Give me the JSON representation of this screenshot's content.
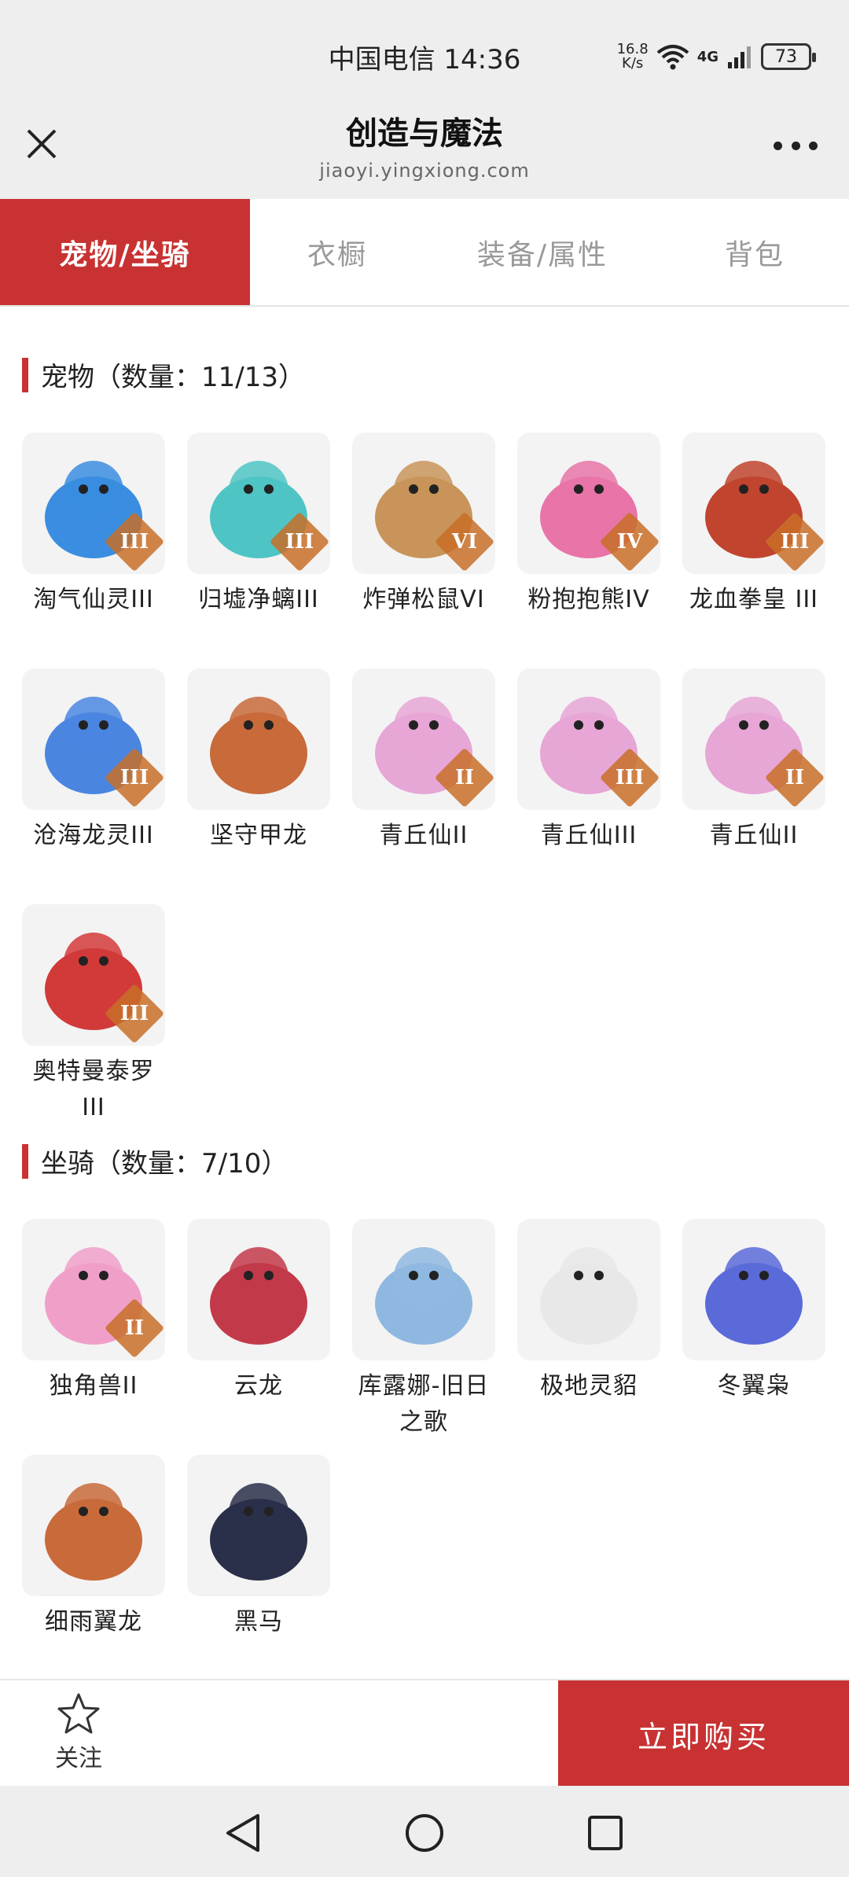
{
  "status_bar": {
    "carrier_time": "中国电信 14:36",
    "net_speed_top": "16.8",
    "net_speed_bottom": "K/s",
    "network": "4G",
    "battery": "73"
  },
  "title_bar": {
    "title": "创造与魔法",
    "subtitle": "jiaoyi.yingxiong.com"
  },
  "tabs": [
    {
      "label": "宠物/坐骑",
      "active": true
    },
    {
      "label": "衣橱",
      "active": false
    },
    {
      "label": "装备/属性",
      "active": false
    },
    {
      "label": "背包",
      "active": false
    }
  ],
  "pets_section": {
    "title": "宠物（数量：11/13）",
    "items": [
      {
        "name": "淘气仙灵III",
        "badge": "III",
        "icon": "blue-creature-icon",
        "color": "#3a8de0"
      },
      {
        "name": "归墟净螭III",
        "badge": "III",
        "icon": "cyan-dragon-icon",
        "color": "#4fc4c4"
      },
      {
        "name": "炸弹松鼠VI",
        "badge": "VI",
        "icon": "squirrel-icon",
        "color": "#c8945a"
      },
      {
        "name": "粉抱抱熊IV",
        "badge": "IV",
        "icon": "pink-bear-icon",
        "color": "#e874a8"
      },
      {
        "name": "龙血拳皇 III",
        "badge": "III",
        "icon": "red-beast-icon",
        "color": "#c0442e"
      },
      {
        "name": "沧海龙灵III",
        "badge": "III",
        "icon": "blue-spirit-icon",
        "color": "#4a86e0"
      },
      {
        "name": "坚守甲龙",
        "badge": "",
        "icon": "armored-dragon-icon",
        "color": "#c86a3a"
      },
      {
        "name": "青丘仙II",
        "badge": "II",
        "icon": "fox-spirit-icon",
        "color": "#e6a6d6"
      },
      {
        "name": "青丘仙III",
        "badge": "III",
        "icon": "fox-spirit-icon",
        "color": "#e6a6d6"
      },
      {
        "name": "青丘仙II",
        "badge": "II",
        "icon": "fox-spirit-icon",
        "color": "#e6a6d6"
      },
      {
        "name": "奥特曼泰罗III",
        "badge": "III",
        "icon": "ultraman-icon",
        "color": "#d23a3a"
      }
    ]
  },
  "mounts_section": {
    "title": "坐骑（数量：7/10）",
    "items": [
      {
        "name": "独角兽II",
        "badge": "II",
        "icon": "unicorn-icon",
        "color": "#f0a0c8"
      },
      {
        "name": "云龙",
        "badge": "",
        "icon": "cloud-dragon-icon",
        "color": "#c23a4a"
      },
      {
        "name": "库露娜-旧日之歌",
        "badge": "",
        "icon": "sheep-girl-icon",
        "color": "#8fb8e0"
      },
      {
        "name": "极地灵貂",
        "badge": "",
        "icon": "white-fox-icon",
        "color": "#e8e8e8"
      },
      {
        "name": "冬翼枭",
        "badge": "",
        "icon": "owl-icon",
        "color": "#5a6ad8"
      },
      {
        "name": "细雨翼龙",
        "badge": "",
        "icon": "pterodactyl-icon",
        "color": "#c86a3a"
      },
      {
        "name": "黑马",
        "badge": "",
        "icon": "black-horse-icon",
        "color": "#2a2f4a"
      }
    ]
  },
  "bottom_bar": {
    "follow_label": "关注",
    "buy_label": "立即购买"
  },
  "colors": {
    "accent": "#c83232"
  }
}
